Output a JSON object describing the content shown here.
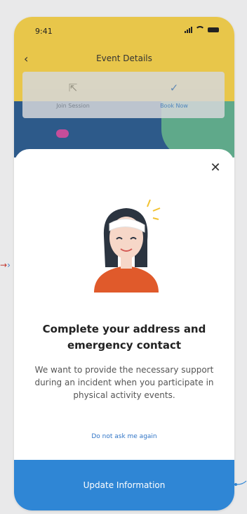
{
  "status": {
    "time": "9:41"
  },
  "nav": {
    "back": "‹",
    "title": "Event Details"
  },
  "actions": [
    {
      "label": "Join Session",
      "icon": "external-link-icon"
    },
    {
      "label": "Book Now",
      "icon": "check-icon"
    }
  ],
  "modal": {
    "title": "Complete your address and emergency contact",
    "message": "We want to provide the necessary support during an incident when you participate in physical activity events.",
    "dismiss_link": "Do not ask me again",
    "cta_label": "Update Information",
    "close_icon": "close-icon"
  },
  "colors": {
    "accent": "#2f86d5",
    "link": "#2f74c6",
    "header": "#e8c64a",
    "illustration_shirt": "#e05a2b"
  }
}
